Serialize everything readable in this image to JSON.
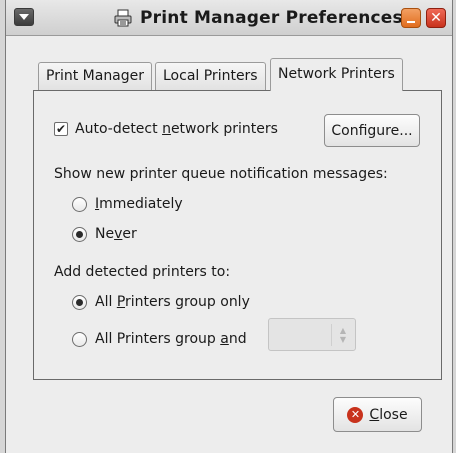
{
  "window": {
    "title": "Print Manager Preferences",
    "minimize_glyph": "",
    "close_glyph": "✕"
  },
  "tabs": [
    {
      "label": "Print Manager"
    },
    {
      "label": "Local Printers"
    },
    {
      "label": "Network Printers",
      "active": true
    }
  ],
  "network": {
    "autodetect_pre": "Auto-detect ",
    "autodetect_u": "n",
    "autodetect_post": "etwork printers",
    "autodetect_checked": true,
    "configure_label": "Configure...",
    "notify_heading": "Show new printer queue notification messages:",
    "immediately_u": "I",
    "immediately_post": "mmediately",
    "never_pre": "Ne",
    "never_u": "v",
    "never_post": "er",
    "notify_selected": "never",
    "add_heading": "Add detected printers to:",
    "group_only_pre": "All ",
    "group_only_u": "P",
    "group_only_post": "rinters group only",
    "group_and_pre": "All Printers group ",
    "group_and_u": "a",
    "group_and_post": "nd",
    "add_selected": "group_only",
    "group_combo_value": ""
  },
  "footer": {
    "close_u": "C",
    "close_post": "lose"
  },
  "icons": {
    "window_menu": "window-menu-icon",
    "printer": "printer-icon",
    "close_button_icon": "close-circle-icon"
  },
  "colors": {
    "minimize": "#e06d1e",
    "close": "#c8321c",
    "window_bg": "#ededed"
  }
}
